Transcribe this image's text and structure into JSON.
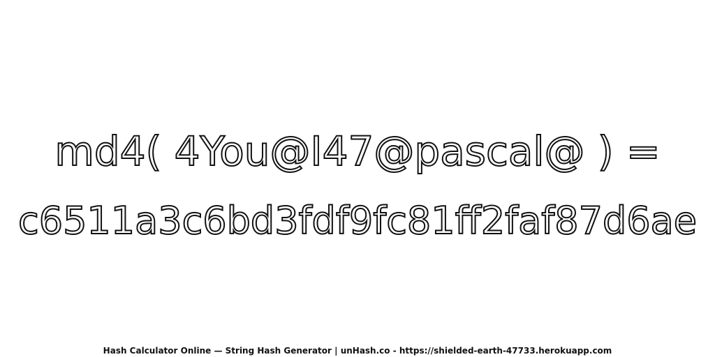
{
  "expression": "md4( 4You@I47@pascal@ ) =",
  "hash_value": "c6511a3c6bd3fdf9fc81ff2faf87d6ae",
  "footer": "Hash Calculator Online — String Hash Generator | unHash.co - https://shielded-earth-47733.herokuapp.com",
  "colors": {
    "background": "#ffffff",
    "text_outline": "#111111",
    "text_fill": "#ffffff"
  }
}
